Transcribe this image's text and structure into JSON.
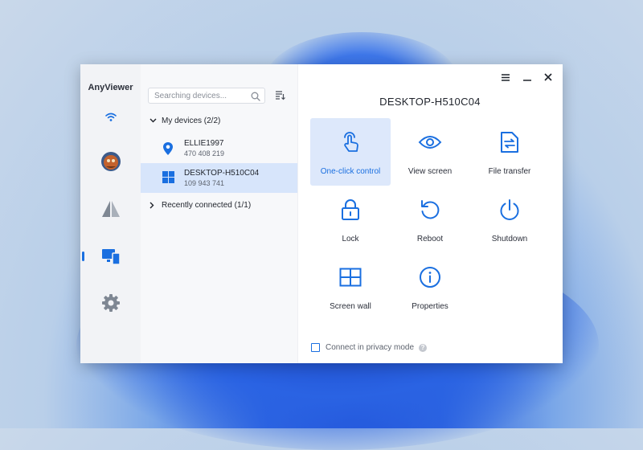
{
  "app": {
    "name": "AnyViewer"
  },
  "colors": {
    "accent": "#1a6fe0",
    "rail_bg": "#f2f3f6",
    "selected_bg": "#d7e5fb"
  },
  "rail": {
    "items": [
      {
        "name": "connection",
        "icon": "wifi-icon"
      },
      {
        "name": "account",
        "icon": "avatar"
      },
      {
        "name": "remote",
        "icon": "triangle-icon"
      },
      {
        "name": "devices",
        "icon": "devices-icon",
        "active": true
      },
      {
        "name": "settings",
        "icon": "gear-icon"
      }
    ]
  },
  "device_panel": {
    "search_placeholder": "Searching devices...",
    "my_devices": {
      "label": "My devices (2/2)",
      "expanded": true,
      "devices": [
        {
          "name": "ELLIE1997",
          "id": "470 408 219",
          "icon": "location-pin-icon",
          "selected": false
        },
        {
          "name": "DESKTOP-H510C04",
          "id": "109 943 741",
          "icon": "windows-icon",
          "selected": true
        }
      ]
    },
    "recently_connected": {
      "label": "Recently connected (1/1)",
      "expanded": false
    }
  },
  "main": {
    "title": "DESKTOP-H510C04",
    "actions": [
      {
        "label": "One-click control",
        "icon": "touch-icon",
        "active": true
      },
      {
        "label": "View screen",
        "icon": "eye-icon"
      },
      {
        "label": "File transfer",
        "icon": "file-transfer-icon"
      },
      {
        "label": "Lock",
        "icon": "lock-icon"
      },
      {
        "label": "Reboot",
        "icon": "reboot-icon"
      },
      {
        "label": "Shutdown",
        "icon": "power-icon"
      },
      {
        "label": "Screen wall",
        "icon": "screen-wall-icon"
      },
      {
        "label": "Properties",
        "icon": "info-icon"
      }
    ],
    "privacy_checkbox": {
      "label": "Connect in privacy mode",
      "checked": false
    }
  }
}
